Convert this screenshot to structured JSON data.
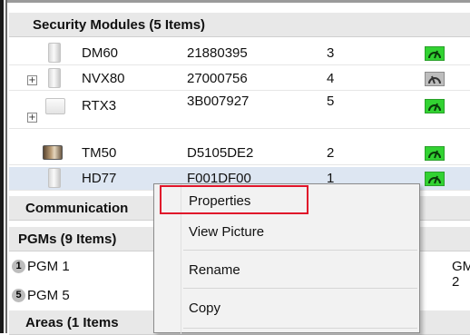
{
  "groups": {
    "security_modules": "Security Modules (5 Items)",
    "communication": "Communication",
    "pgms": "PGMs (9 Items)",
    "areas": "Areas (1 Items"
  },
  "modules": [
    {
      "name": "DM60",
      "serial": "21880395",
      "num": "3",
      "status": "online",
      "expander": false
    },
    {
      "name": "NVX80",
      "serial": "27000756",
      "num": "4",
      "status": "offline",
      "expander": true
    },
    {
      "name": "RTX3",
      "serial": "3B007927",
      "num": "5",
      "status": "online",
      "expander": true
    },
    {
      "name": "TM50",
      "serial": "D5105DE2",
      "num": "2",
      "status": "online",
      "expander": false
    },
    {
      "name": "HD77",
      "serial": "F001DF00",
      "num": "1",
      "status": "online",
      "expander": false
    }
  ],
  "pgm_rows": [
    {
      "badge": "1",
      "label": "PGM 1",
      "right": "GM 2"
    },
    {
      "badge": "5",
      "label": "PGM 5",
      "right": ""
    }
  ],
  "expander_symbol": "+",
  "context_menu": {
    "items": [
      "Properties",
      "View Picture",
      "Rename",
      "Copy"
    ]
  },
  "colors": {
    "online": "#32d232",
    "offline": "#bdbdbd",
    "highlight": "#e0142a"
  }
}
